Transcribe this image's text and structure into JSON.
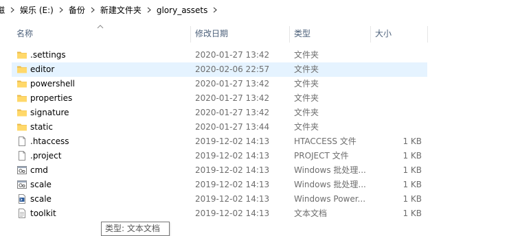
{
  "breadcrumb": {
    "items": [
      "磁",
      "娱乐 (E:)",
      "备份",
      "新建文件夹",
      "glory_assets"
    ]
  },
  "columns": {
    "name": "名称",
    "date": "修改日期",
    "type": "类型",
    "size": "大小"
  },
  "rows": [
    {
      "name": ".settings",
      "date": "2020-01-27 13:42",
      "type": "文件夹",
      "size": "",
      "icon": "folder-icon"
    },
    {
      "name": "editor",
      "date": "2020-02-06 22:57",
      "type": "文件夹",
      "size": "",
      "icon": "folder-icon",
      "hover": true
    },
    {
      "name": "powershell",
      "date": "2020-01-27 13:42",
      "type": "文件夹",
      "size": "",
      "icon": "folder-icon"
    },
    {
      "name": "properties",
      "date": "2020-01-27 13:42",
      "type": "文件夹",
      "size": "",
      "icon": "folder-icon"
    },
    {
      "name": "signature",
      "date": "2020-01-27 13:42",
      "type": "文件夹",
      "size": "",
      "icon": "folder-icon"
    },
    {
      "name": "static",
      "date": "2020-01-27 13:44",
      "type": "文件夹",
      "size": "",
      "icon": "folder-icon"
    },
    {
      "name": ".htaccess",
      "date": "2019-12-02 14:13",
      "type": "HTACCESS 文件",
      "size": "1 KB",
      "icon": "file-icon"
    },
    {
      "name": ".project",
      "date": "2019-12-02 14:13",
      "type": "PROJECT 文件",
      "size": "1 KB",
      "icon": "file-icon"
    },
    {
      "name": "cmd",
      "date": "2019-12-02 14:13",
      "type": "Windows 批处理...",
      "size": "1 KB",
      "icon": "batch-file-icon"
    },
    {
      "name": "scale",
      "date": "2019-12-02 14:13",
      "type": "Windows 批处理...",
      "size": "1 KB",
      "icon": "batch-file-icon"
    },
    {
      "name": "scale",
      "date": "2019-12-02 14:13",
      "type": "Windows Power...",
      "size": "1 KB",
      "icon": "powershell-file-icon"
    },
    {
      "name": "toolkit",
      "date": "2019-12-02 14:13",
      "type": "文本文档",
      "size": "1 KB",
      "icon": "text-file-icon"
    }
  ],
  "tooltip": {
    "text": "类型: 文本文档"
  },
  "colors": {
    "hover_row": "#e5f3ff",
    "folder": "#ffd86a",
    "header_text": "#4c607a",
    "detail_text": "#6d6d6d"
  }
}
